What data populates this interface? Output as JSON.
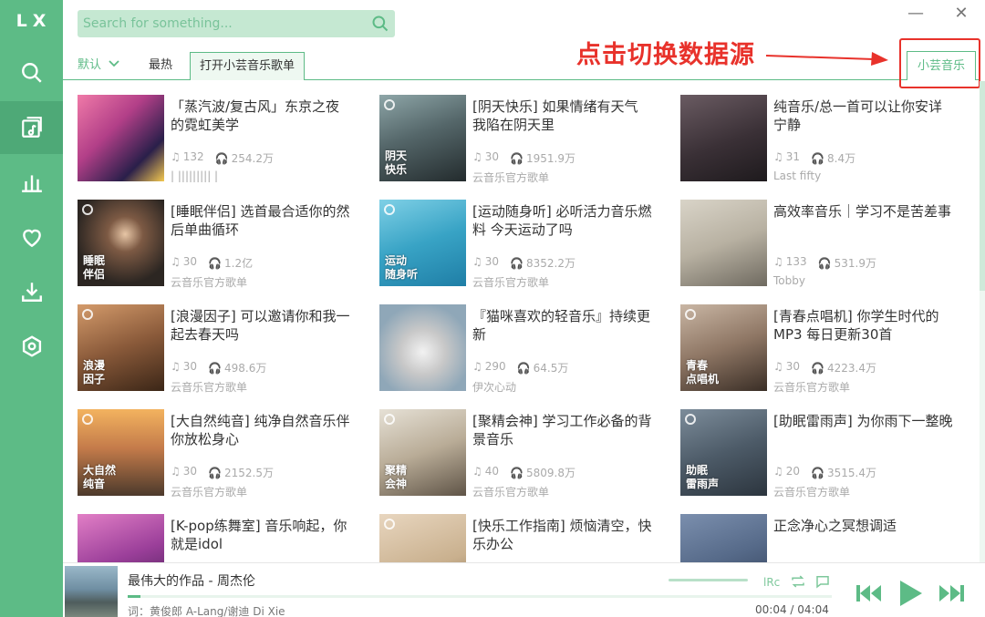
{
  "app": {
    "logo": "LX"
  },
  "search": {
    "placeholder": "Search for something..."
  },
  "window": {
    "minimize": "—",
    "close": "✕"
  },
  "tabs": {
    "sort": "默认",
    "hot": "最热",
    "open_list": "打开小芸音乐歌单",
    "source": "小芸音乐"
  },
  "annotation": {
    "text": "点击切换数据源",
    "color": "#e8322b"
  },
  "colors": {
    "accent": "#5dbb86",
    "accent_dark": "#4ea977",
    "annotation": "#e8322b"
  },
  "playlists": [
    {
      "title": "「蒸汽波/复古风」东京之夜的霓虹美学",
      "songs": "132",
      "plays": "254.2万",
      "author": "| ||||||||| |",
      "overlay": "",
      "cover": "linear-gradient(135deg,#f07aa8 0%,#b23f88 40%,#2a1f4a 75%,#f4c94f 100%)",
      "badge": false
    },
    {
      "title": "[阴天快乐] 如果情绪有天气 我陷在阴天里",
      "songs": "30",
      "plays": "1951.9万",
      "author": "云音乐官方歌单",
      "overlay": "阴天\n快乐",
      "cover": "linear-gradient(160deg,#8ea6a8 0%,#55676a 45%,#232b2d 100%)",
      "badge": true
    },
    {
      "title": "纯音乐/总一首可以让你安详宁静",
      "songs": "31",
      "plays": "8.4万",
      "author": "Last fifty",
      "overlay": "",
      "cover": "linear-gradient(160deg,#6a5b62 0%,#3a3036 55%,#1e1a1d 100%)",
      "badge": false
    },
    {
      "title": "[睡眠伴侣] 选首最合适你的然后单曲循环",
      "songs": "30",
      "plays": "1.2亿",
      "author": "云音乐官方歌单",
      "overlay": "睡眠\n伴侣",
      "cover": "radial-gradient(circle at 55% 40%,#e7c6a6 0%,#7d5a44 25%,#2c2622 70%)",
      "badge": true
    },
    {
      "title": "[运动随身听] 必听活力音乐燃料 今天运动了吗",
      "songs": "30",
      "plays": "8352.2万",
      "author": "云音乐官方歌单",
      "overlay": "运动\n随身听",
      "cover": "linear-gradient(160deg,#7fd0e6 0%,#38a3c5 50%,#1f7ea6 100%)",
      "badge": true
    },
    {
      "title": "高效率音乐｜学习不是苦差事",
      "songs": "133",
      "plays": "531.9万",
      "author": "Tobby",
      "overlay": "",
      "cover": "linear-gradient(160deg,#d9d4c8 0%,#b8b1a2 50%,#6f6a60 100%)",
      "badge": false
    },
    {
      "title": "[浪漫因子] 可以邀请你和我一起去春天吗",
      "songs": "30",
      "plays": "498.6万",
      "author": "云音乐官方歌单",
      "overlay": "浪漫\n因子",
      "cover": "linear-gradient(160deg,#d49b6b 0%,#8a5a3a 50%,#3b2617 100%)",
      "badge": true
    },
    {
      "title": "『猫咪喜欢的轻音乐』持续更新",
      "songs": "290",
      "plays": "64.5万",
      "author": "伊次心动",
      "overlay": "",
      "cover": "radial-gradient(circle at 50% 55%,#f2f2f2 0%,#c8c8c8 35%,#8fa7b8 75%)",
      "badge": false
    },
    {
      "title": "[青春点唱机] 你学生时代的MP3 每日更新30首",
      "songs": "30",
      "plays": "4223.4万",
      "author": "云音乐官方歌单",
      "overlay": "青春\n点唱机",
      "cover": "linear-gradient(160deg,#c9b6a4 0%,#8e7664 50%,#3a2e26 100%)",
      "badge": true
    },
    {
      "title": "[大自然纯音] 纯净自然音乐伴你放松身心",
      "songs": "30",
      "plays": "2152.5万",
      "author": "云音乐官方歌单",
      "overlay": "大自然\n纯音",
      "cover": "linear-gradient(180deg,#f3b35f 0%,#c47b4a 45%,#4c3a2c 100%)",
      "badge": true
    },
    {
      "title": "[聚精会神] 学习工作必备的背景音乐",
      "songs": "40",
      "plays": "5809.8万",
      "author": "云音乐官方歌单",
      "overlay": "聚精\n会神",
      "cover": "linear-gradient(160deg,#e6e1d6 0%,#b9ac97 50%,#5f5447 100%)",
      "badge": true
    },
    {
      "title": "[助眠雷雨声] 为你雨下一整晚",
      "songs": "20",
      "plays": "3515.4万",
      "author": "云音乐官方歌单",
      "overlay": "助眠\n雷雨声",
      "cover": "linear-gradient(160deg,#7c8c9a 0%,#4d5b68 50%,#2c353e 100%)",
      "badge": true
    },
    {
      "title": "[K-pop练舞室] 音乐响起，你就是idol",
      "songs": "",
      "plays": "",
      "author": "",
      "overlay": "",
      "cover": "linear-gradient(160deg,#e27fc6 0%,#9b3f9a 50%,#401b4f 100%)",
      "badge": false
    },
    {
      "title": "[快乐工作指南] 烦恼清空，快乐办公",
      "songs": "",
      "plays": "",
      "author": "",
      "overlay": "",
      "cover": "linear-gradient(160deg,#e8d6bf 0%,#c9b08e 60%,#8a7357 100%)",
      "badge": true
    },
    {
      "title": "正念净心之冥想调适",
      "songs": "",
      "plays": "",
      "author": "",
      "overlay": "",
      "cover": "linear-gradient(160deg,#7b8fae 0%,#566a89 50%,#2f3d55 100%)",
      "badge": false
    }
  ],
  "player": {
    "title": "最伟大的作品 - 周杰伦",
    "lyric": "词：黄俊郎 A-Lang/谢迪 Di Xie",
    "time": "00:04 / 04:04",
    "progress": 0.018
  }
}
